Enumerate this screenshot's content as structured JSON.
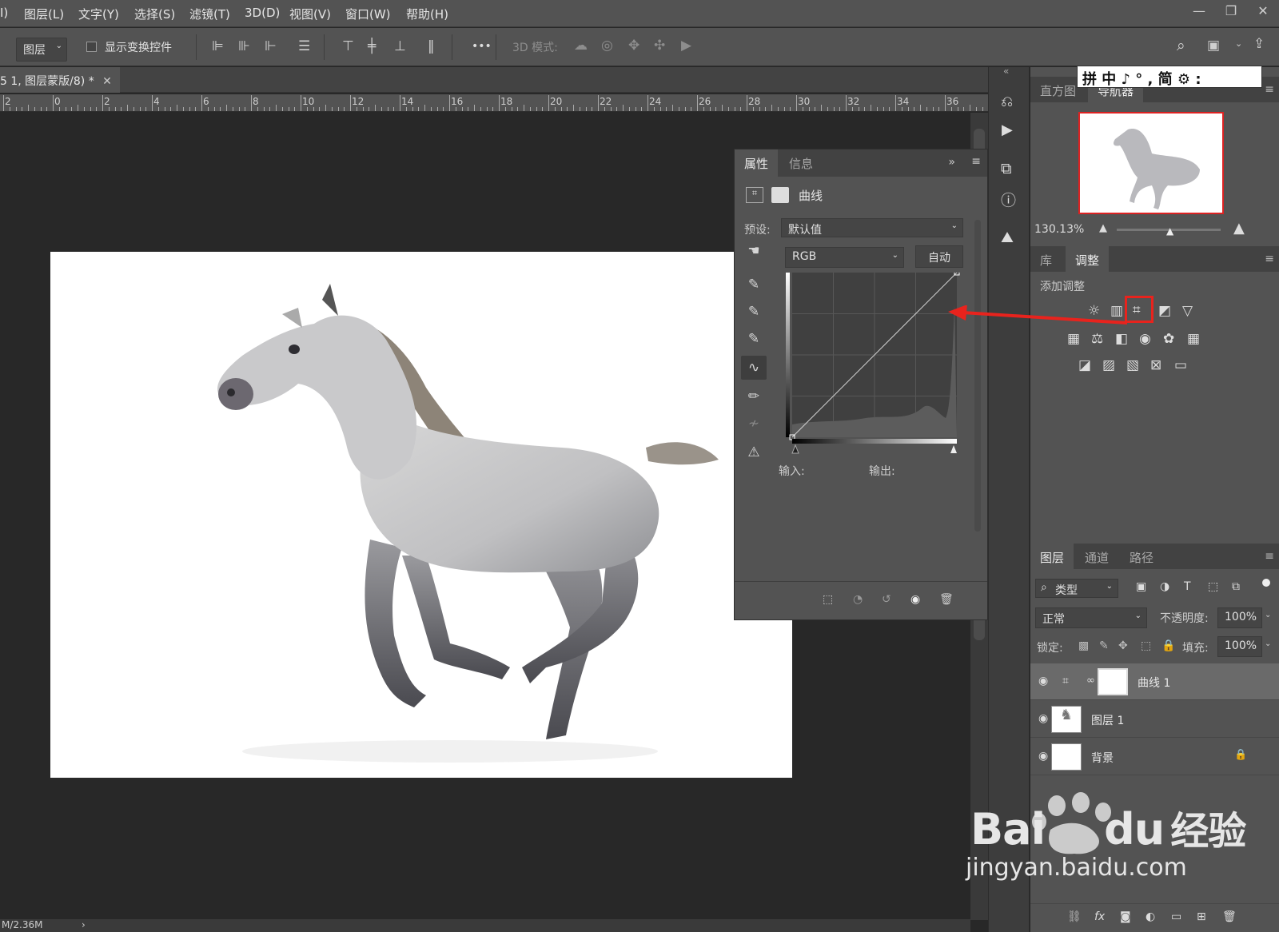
{
  "menu": {
    "items": [
      "I)",
      "图层(L)",
      "文字(Y)",
      "选择(S)",
      "滤镜(T)",
      "3D(D)",
      "视图(V)",
      "窗口(W)",
      "帮助(H)"
    ]
  },
  "options_bar": {
    "layer_select": "图层",
    "show_transform": "显示变换控件",
    "mode_3d": "3D 模式:",
    "more": "•••"
  },
  "document": {
    "tab_title": "5 1, 图层蒙版/8) *",
    "status": "M/2.36M"
  },
  "ruler": {
    "labels": [
      "2",
      "0",
      "2",
      "4",
      "6",
      "8",
      "10",
      "12",
      "14",
      "16",
      "18",
      "20",
      "22",
      "24",
      "26",
      "28",
      "30",
      "32",
      "34",
      "36"
    ]
  },
  "properties": {
    "tabs": [
      "属性",
      "信息"
    ],
    "title": "曲线",
    "preset_label": "预设:",
    "preset_value": "默认值",
    "channel": "RGB",
    "auto": "自动",
    "input_label": "输入:",
    "output_label": "输出:",
    "curve_points": [
      [
        0,
        0
      ],
      [
        255,
        255
      ]
    ]
  },
  "navigator": {
    "tabs": [
      "直方图",
      "导航器"
    ],
    "zoom": "130.13%"
  },
  "ime": {
    "text": "拼 中 ♪ ° , 简 ⚙ :"
  },
  "adjustments": {
    "tabs": [
      "库",
      "调整"
    ],
    "header": "添加调整"
  },
  "layers": {
    "tabs": [
      "图层",
      "通道",
      "路径"
    ],
    "filter": "类型",
    "blend_mode": "正常",
    "opacity_label": "不透明度:",
    "opacity": "100%",
    "lock_label": "锁定:",
    "fill_label": "填充:",
    "fill": "100%",
    "items": [
      {
        "name": "曲线 1",
        "selected": true
      },
      {
        "name": "图层 1",
        "selected": false
      },
      {
        "name": "背景",
        "selected": false,
        "locked": true
      }
    ]
  },
  "watermark": {
    "brand": "Bai",
    "brand2": "du",
    "cn": "经验",
    "url": "jingyan.baidu.com"
  },
  "colors": {
    "panel": "#535353",
    "highlight_red": "#e8231d"
  }
}
